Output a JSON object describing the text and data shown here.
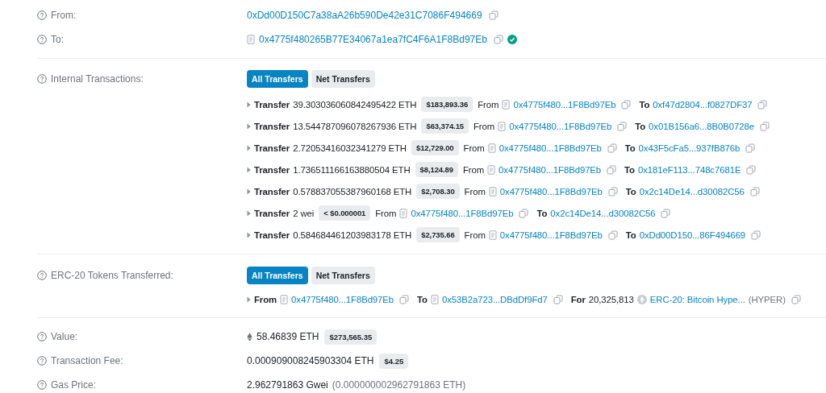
{
  "parties": [
    {
      "label": "From:",
      "address": "0xDd00D150C7a38aA26b590De42e31C7086F494669",
      "contract": false,
      "verified": false
    },
    {
      "label": "To:",
      "address": "0x4775f480265B77E34067a1ea7fC4F6A1F8Bd97Eb",
      "contract": true,
      "verified": true
    }
  ],
  "internal_transactions": {
    "label": "Internal Transactions:",
    "tabs": [
      {
        "label": "All Transfers",
        "selected": true
      },
      {
        "label": "Net Transfers",
        "selected": false
      }
    ],
    "transfers": [
      {
        "word": "Transfer",
        "amount": "39.303036060842495422 ETH",
        "usd": "$183,893.36",
        "from_word": "From",
        "from": "0x4775f480...1F8Bd97Eb",
        "from_contract": true,
        "to_word": "To",
        "to": "0xf47d2804...f0827DF37",
        "to_contract": false
      },
      {
        "word": "Transfer",
        "amount": "13.544787096078267936 ETH",
        "usd": "$63,374.15",
        "from_word": "From",
        "from": "0x4775f480...1F8Bd97Eb",
        "from_contract": true,
        "to_word": "To",
        "to": "0x01B156a6...8B0B0728e",
        "to_contract": false
      },
      {
        "word": "Transfer",
        "amount": "2.72053416032341279 ETH",
        "usd": "$12,729.00",
        "from_word": "From",
        "from": "0x4775f480...1F8Bd97Eb",
        "from_contract": true,
        "to_word": "To",
        "to": "0x43F5cFa5...937fB876b",
        "to_contract": false
      },
      {
        "word": "Transfer",
        "amount": "1.736511166163880504 ETH",
        "usd": "$8,124.89",
        "from_word": "From",
        "from": "0x4775f480...1F8Bd97Eb",
        "from_contract": true,
        "to_word": "To",
        "to": "0x181eF113...748c7681E",
        "to_contract": false
      },
      {
        "word": "Transfer",
        "amount": "0.578837055387960168 ETH",
        "usd": "$2,708.30",
        "from_word": "From",
        "from": "0x4775f480...1F8Bd97Eb",
        "from_contract": true,
        "to_word": "To",
        "to": "0x2c14De14...d30082C56",
        "to_contract": false
      },
      {
        "word": "Transfer",
        "amount": "2 wei",
        "usd": "< $0.000001",
        "from_word": "From",
        "from": "0x4775f480...1F8Bd97Eb",
        "from_contract": true,
        "to_word": "To",
        "to": "0x2c14De14...d30082C56",
        "to_contract": false
      },
      {
        "word": "Transfer",
        "amount": "0.584684461203983178 ETH",
        "usd": "$2,735.66",
        "from_word": "From",
        "from": "0x4775f480...1F8Bd97Eb",
        "from_contract": true,
        "to_word": "To",
        "to": "0xDd00D150...86F494669",
        "to_contract": false
      }
    ]
  },
  "token_transfers": {
    "label": "ERC-20 Tokens Transferred:",
    "tabs": [
      {
        "label": "All Transfers",
        "selected": true
      },
      {
        "label": "Net Transfers",
        "selected": false
      }
    ],
    "transfers": [
      {
        "from_word": "From",
        "from": "0x4775f480...1F8Bd97Eb",
        "from_contract": true,
        "to_word": "To",
        "to": "0x53B2a723...DBdDf9Fd7",
        "to_contract": true,
        "for_word": "For",
        "amount": "20,325,813",
        "token": "ERC-20: Bitcoin Hype...",
        "symbol": "(HYPER)"
      }
    ]
  },
  "details": [
    {
      "label": "Value:",
      "eth_icon": true,
      "amount": "58.46839 ETH",
      "usd": "$273,565.35"
    },
    {
      "label": "Transaction Fee:",
      "eth_icon": false,
      "amount": "0.000909008245903304 ETH",
      "usd": "$4.25"
    },
    {
      "label": "Gas Price:",
      "eth_icon": false,
      "amount": "2.962791863 Gwei",
      "note": "(0.000000002962791863 ETH)"
    }
  ]
}
